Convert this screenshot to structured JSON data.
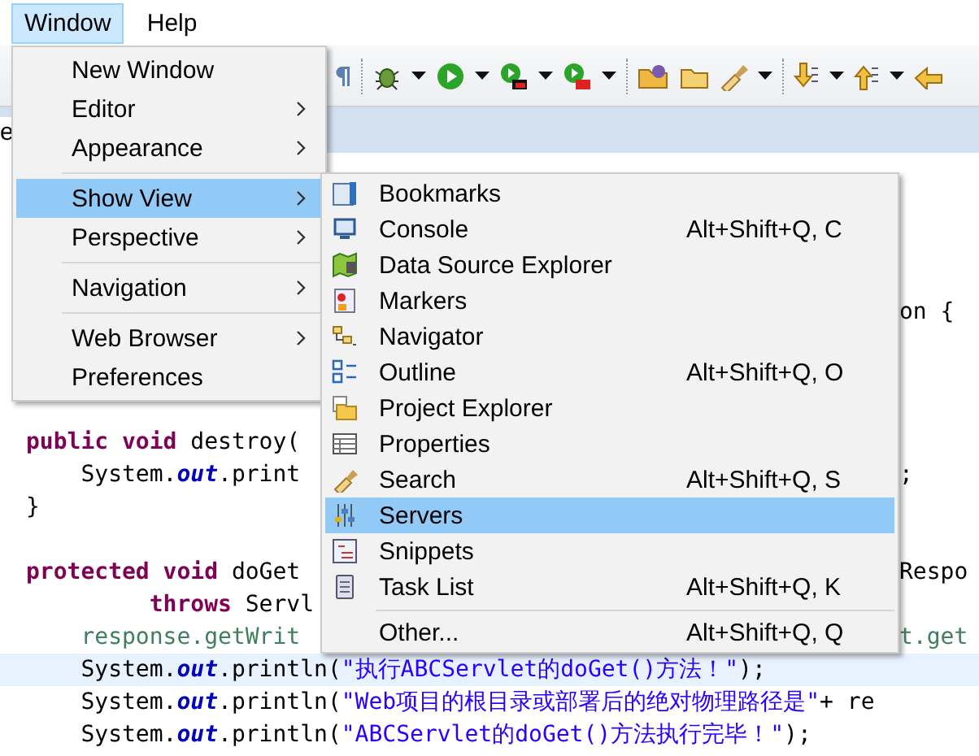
{
  "menubar": [
    {
      "label": "Window",
      "selected": true
    },
    {
      "label": "Help",
      "selected": false
    }
  ],
  "editor_tab": {
    "label": "e"
  },
  "window_menu": {
    "items": [
      {
        "kind": "item",
        "label": "New Window",
        "submenu": false,
        "selected": false
      },
      {
        "kind": "item",
        "label": "Editor",
        "submenu": true,
        "selected": false
      },
      {
        "kind": "item",
        "label": "Appearance",
        "submenu": true,
        "selected": false
      },
      {
        "kind": "separator"
      },
      {
        "kind": "item",
        "label": "Show View",
        "submenu": true,
        "selected": true
      },
      {
        "kind": "item",
        "label": "Perspective",
        "submenu": true,
        "selected": false
      },
      {
        "kind": "separator"
      },
      {
        "kind": "item",
        "label": "Navigation",
        "submenu": true,
        "selected": false
      },
      {
        "kind": "separator"
      },
      {
        "kind": "item",
        "label": "Web Browser",
        "submenu": true,
        "selected": false
      },
      {
        "kind": "item",
        "label": "Preferences",
        "submenu": false,
        "selected": false
      }
    ]
  },
  "show_view_menu": {
    "items": [
      {
        "kind": "item",
        "label": "Bookmarks",
        "selected": false
      },
      {
        "kind": "item",
        "label": "Console",
        "shortcut": "Alt+Shift+Q, C",
        "selected": false
      },
      {
        "kind": "item",
        "label": "Data Source Explorer",
        "selected": false
      },
      {
        "kind": "item",
        "label": "Markers",
        "selected": false
      },
      {
        "kind": "item",
        "label": "Navigator",
        "selected": false
      },
      {
        "kind": "item",
        "label": "Outline",
        "shortcut": "Alt+Shift+Q, O",
        "selected": false
      },
      {
        "kind": "item",
        "label": "Project Explorer",
        "selected": false
      },
      {
        "kind": "item",
        "label": "Properties",
        "selected": false
      },
      {
        "kind": "item",
        "label": "Search",
        "shortcut": "Alt+Shift+Q, S",
        "selected": false
      },
      {
        "kind": "item",
        "label": "Servers",
        "selected": true
      },
      {
        "kind": "item",
        "label": "Snippets",
        "selected": false
      },
      {
        "kind": "item",
        "label": "Task List",
        "shortcut": "Alt+Shift+Q, K",
        "selected": false
      },
      {
        "kind": "separator"
      },
      {
        "kind": "item",
        "label": "Other...",
        "shortcut": "Alt+Shift+Q, Q",
        "selected": false
      }
    ]
  },
  "code_lines": [
    {
      "kind": "blank"
    },
    {
      "kind": "blank"
    },
    {
      "kind": "blank"
    },
    {
      "kind": "blank"
    },
    {
      "kind": "code",
      "current": false,
      "right": [
        {
          "text": "on {",
          "kind": "plain"
        }
      ]
    },
    {
      "kind": "blank"
    },
    {
      "kind": "blank"
    },
    {
      "kind": "blank"
    },
    {
      "kind": "code",
      "current": false,
      "tokens": [
        {
          "text": "public",
          "kind": "keyword"
        },
        {
          "text": " void",
          "kind": "keyword"
        },
        {
          "text": " destroy(",
          "kind": "plain"
        }
      ]
    },
    {
      "kind": "code",
      "current": false,
      "tokens": [
        {
          "text": "    System.",
          "kind": "plain"
        },
        {
          "text": "out",
          "kind": "field"
        },
        {
          "text": ".print",
          "kind": "plain"
        }
      ],
      "right": [
        {
          "text": ";",
          "kind": "plain"
        }
      ]
    },
    {
      "kind": "code",
      "current": false,
      "tokens": [
        {
          "text": "}",
          "kind": "plain"
        }
      ]
    },
    {
      "kind": "blank"
    },
    {
      "kind": "code",
      "current": false,
      "tokens": [
        {
          "text": "protected",
          "kind": "keyword"
        },
        {
          "text": " void",
          "kind": "keyword"
        },
        {
          "text": " doGet",
          "kind": "plain"
        }
      ],
      "right": [
        {
          "text": "Respo",
          "kind": "plain"
        }
      ]
    },
    {
      "kind": "code",
      "current": false,
      "tokens": [
        {
          "text": "         throws",
          "kind": "keyword"
        },
        {
          "text": " Servl",
          "kind": "plain"
        }
      ]
    },
    {
      "kind": "code",
      "current": false,
      "tokens": [
        {
          "text": "    response.getWrit",
          "kind": "comment"
        }
      ],
      "right": [
        {
          "text": "t.get",
          "kind": "comment"
        }
      ]
    },
    {
      "kind": "code",
      "current": true,
      "tokens": [
        {
          "text": "    System.",
          "kind": "plain"
        },
        {
          "text": "out",
          "kind": "field"
        },
        {
          "text": ".println(",
          "kind": "plain"
        },
        {
          "text": "\"执行ABCServlet的doGet()方法！\"",
          "kind": "string"
        },
        {
          "text": ");",
          "kind": "plain"
        }
      ]
    },
    {
      "kind": "code",
      "current": false,
      "tokens": [
        {
          "text": "    System.",
          "kind": "plain"
        },
        {
          "text": "out",
          "kind": "field"
        },
        {
          "text": ".println(",
          "kind": "plain"
        },
        {
          "text": "\"Web项目的根目录或部署后的绝对物理路径是\"",
          "kind": "string"
        },
        {
          "text": "+ re",
          "kind": "plain"
        }
      ]
    },
    {
      "kind": "code",
      "current": false,
      "tokens": [
        {
          "text": "    System.",
          "kind": "plain"
        },
        {
          "text": "out",
          "kind": "field"
        },
        {
          "text": ".println(",
          "kind": "plain"
        },
        {
          "text": "\"ABCServlet的doGet()方法执行完毕！\"",
          "kind": "string"
        },
        {
          "text": ");",
          "kind": "plain"
        }
      ]
    }
  ]
}
